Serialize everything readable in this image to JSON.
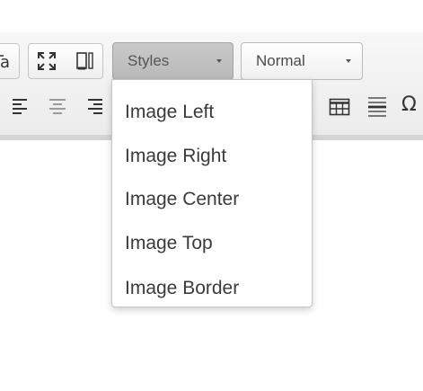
{
  "toolbar": {
    "styles_combo": {
      "label": "Styles",
      "state": "open"
    },
    "format_combo": {
      "label": "Normal"
    },
    "special_char_symbol": "Ω",
    "icons": [
      "paste-from-word-icon",
      "maximize-icon",
      "show-blocks-icon",
      "align-left-icon",
      "align-center-icon",
      "align-right-icon",
      "table-icon",
      "horizontal-rule-icon",
      "special-char-icon"
    ]
  },
  "styles_menu": {
    "items": [
      {
        "label": "Image Left"
      },
      {
        "label": "Image Right"
      },
      {
        "label": "Image Center"
      },
      {
        "label": "Image Top"
      },
      {
        "label": "Image Border"
      }
    ]
  }
}
